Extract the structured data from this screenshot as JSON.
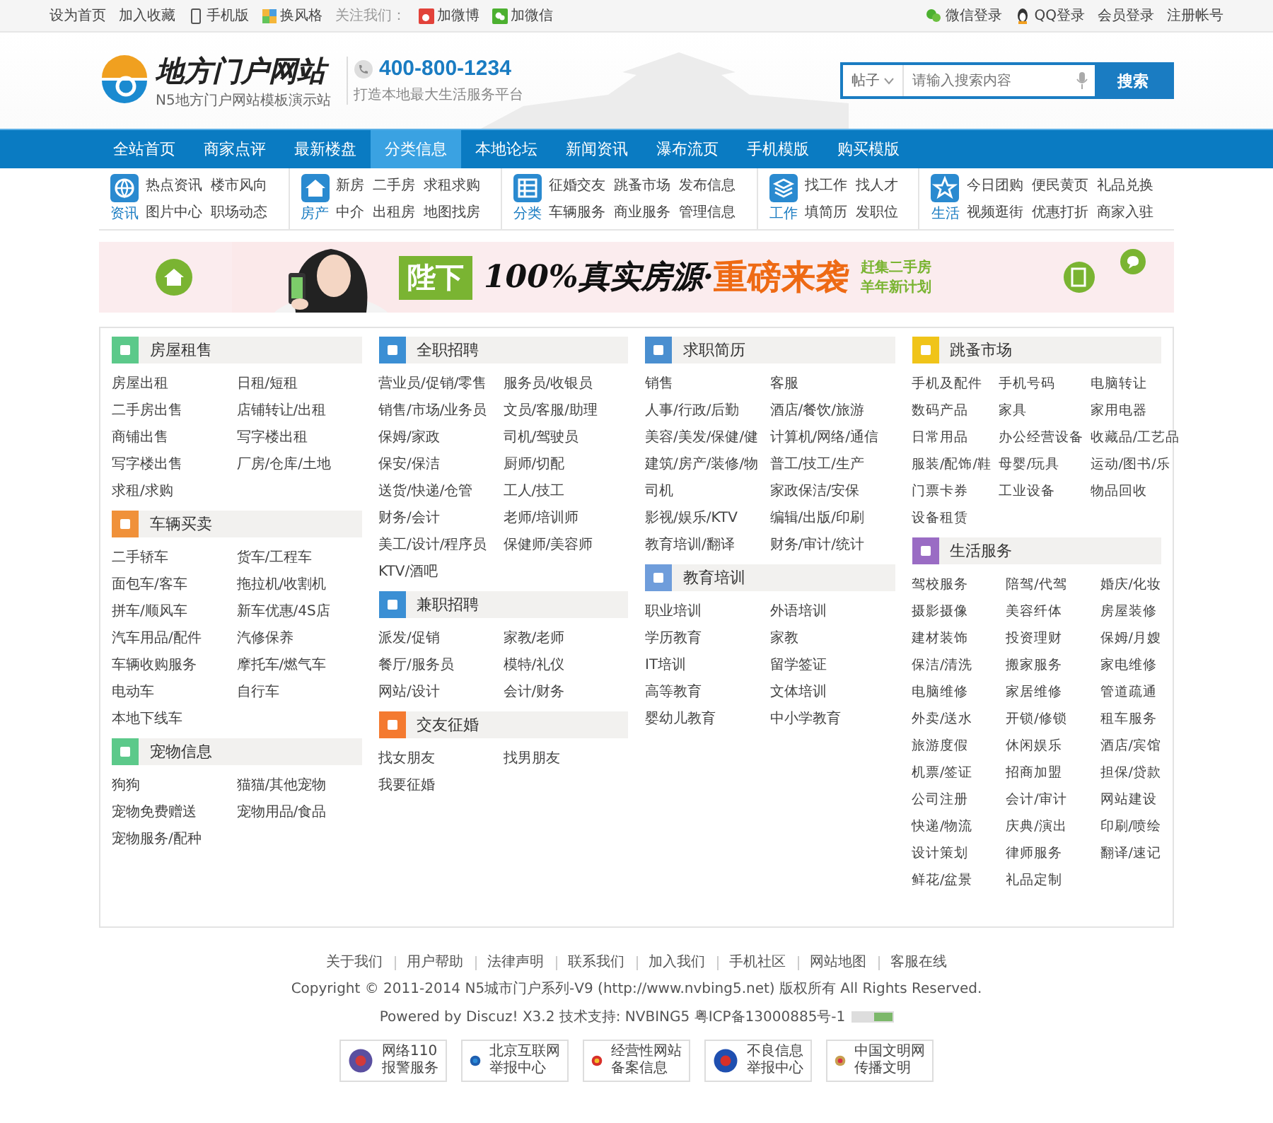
{
  "topbar": {
    "left": [
      {
        "text": "设为首页",
        "kind": "link"
      },
      {
        "text": "加入收藏",
        "kind": "link"
      },
      {
        "text": "手机版",
        "kind": "phone"
      },
      {
        "text": "换风格",
        "kind": "style"
      },
      {
        "text": "关注我们：",
        "kind": "label"
      },
      {
        "text": "加微博",
        "kind": "weibo"
      },
      {
        "text": "加微信",
        "kind": "wechat"
      }
    ],
    "right": [
      {
        "text": "微信登录",
        "kind": "wechat"
      },
      {
        "text": "QQ登录",
        "kind": "qq"
      },
      {
        "text": "会员登录",
        "kind": "link"
      },
      {
        "text": "注册帐号",
        "kind": "link"
      }
    ]
  },
  "header": {
    "logo_title": "地方门户网站",
    "logo_subtitle": "N5地方门户网站模板演示站",
    "phone": "400-800-1234",
    "slogan": "打造本地最大生活服务平台",
    "search": {
      "scope": "帖子",
      "placeholder": "请输入搜索内容",
      "button": "搜索"
    }
  },
  "nav": [
    {
      "label": "全站首页",
      "selected": false
    },
    {
      "label": "商家点评",
      "selected": false
    },
    {
      "label": "最新楼盘",
      "selected": false
    },
    {
      "label": "分类信息",
      "selected": true
    },
    {
      "label": "本地论坛",
      "selected": false
    },
    {
      "label": "新闻资讯",
      "selected": false
    },
    {
      "label": "瀑布流页",
      "selected": false
    },
    {
      "label": "手机模版",
      "selected": false
    },
    {
      "label": "购买模版",
      "selected": false
    }
  ],
  "subnav": [
    {
      "label": "资讯",
      "rows": [
        [
          "热点资讯",
          "楼市风向"
        ],
        [
          "图片中心",
          "职场动态"
        ]
      ]
    },
    {
      "label": "房产",
      "rows": [
        [
          "新房",
          "二手房",
          "求租求购"
        ],
        [
          "中介",
          "出租房",
          "地图找房"
        ]
      ]
    },
    {
      "label": "分类",
      "rows": [
        [
          "征婚交友",
          "跳蚤市场",
          "发布信息"
        ],
        [
          "车辆服务",
          "商业服务",
          "管理信息"
        ]
      ]
    },
    {
      "label": "工作",
      "rows": [
        [
          "找工作",
          "找人才"
        ],
        [
          "填简历",
          "发职位"
        ]
      ]
    },
    {
      "label": "生活",
      "rows": [
        [
          "今日团购",
          "便民黄页",
          "礼品兑换"
        ],
        [
          "视频逛街",
          "优惠打折",
          "商家入驻"
        ]
      ]
    }
  ],
  "banner": {
    "badge": "陛下",
    "headline": "100%真实房源·",
    "highlight": "重磅来袭",
    "side": [
      "赶集二手房",
      "羊年新计划"
    ]
  },
  "categories": [
    [
      {
        "title": "房屋租售",
        "color": "#5cc98a",
        "items": [
          "房屋出租",
          "日租/短租",
          "二手房出售",
          "店铺转让/出租",
          "商铺出售",
          "写字楼出租",
          "写字楼出售",
          "厂房/仓库/土地",
          "求租/求购"
        ]
      },
      {
        "title": "车辆买卖",
        "color": "#f0913a",
        "items": [
          "二手轿车",
          "货车/工程车",
          "面包车/客车",
          "拖拉机/收割机",
          "拼车/顺风车",
          "新车优惠/4S店",
          "汽车用品/配件",
          "汽修保养",
          "车辆收购服务",
          "摩托车/燃气车",
          "电动车",
          "自行车",
          "本地下线车"
        ]
      },
      {
        "title": "宠物信息",
        "color": "#5cc98a",
        "items": [
          "狗狗",
          "猫猫/其他宠物",
          "宠物免费赠送",
          "宠物用品/食品",
          "宠物服务/配种"
        ]
      }
    ],
    [
      {
        "title": "全职招聘",
        "color": "#3b8fd4",
        "items": [
          "营业员/促销/零售",
          "服务员/收银员",
          "销售/市场/业务员",
          "文员/客服/助理",
          "保姆/家政",
          "司机/驾驶员",
          "保安/保洁",
          "厨师/切配",
          "送货/快递/仓管",
          "工人/技工",
          "财务/会计",
          "老师/培训师",
          "美工/设计/程序员",
          "保健师/美容师",
          "KTV/酒吧"
        ]
      },
      {
        "title": "兼职招聘",
        "color": "#3b8fd4",
        "items": [
          "派发/促销",
          "家教/老师",
          "餐厅/服务员",
          "模特/礼仪",
          "网站/设计",
          "会计/财务"
        ]
      },
      {
        "title": "交友征婚",
        "color": "#f47a30",
        "items": [
          "找女朋友",
          "找男朋友",
          "我要征婚"
        ]
      }
    ],
    [
      {
        "title": "求职简历",
        "color": "#4a8fd0",
        "items": [
          "销售",
          "客服",
          "人事/行政/后勤",
          "酒店/餐饮/旅游",
          "美容/美发/保健/健",
          "计算机/网络/通信",
          "建筑/房产/装修/物",
          "普工/技工/生产",
          "司机",
          "家政保洁/安保",
          "影视/娱乐/KTV",
          "编辑/出版/印刷",
          "教育培训/翻译",
          "财务/审计/统计"
        ]
      },
      {
        "title": "教育培训",
        "color": "#6f9ddb",
        "items": [
          "职业培训",
          "外语培训",
          "学历教育",
          "家教",
          "IT培训",
          "留学签证",
          "高等教育",
          "文体培训",
          "婴幼儿教育",
          "中小学教育"
        ]
      }
    ],
    [
      {
        "title": "跳蚤市场",
        "color": "#f0c419",
        "items": [
          "手机及配件",
          "手机号码",
          "电脑转让",
          "数码产品",
          "家具",
          "家用电器",
          "日常用品",
          "办公经营设备",
          "收藏品/工艺品",
          "服装/配饰/鞋",
          "母婴/玩具",
          "运动/图书/乐",
          "门票卡券",
          "工业设备",
          "物品回收",
          "设备租赁"
        ]
      },
      {
        "title": "生活服务",
        "color": "#9a6cc4",
        "items": [
          "驾校服务",
          "陪驾/代驾",
          "婚庆/化妆",
          "摄影摄像",
          "美容纤体",
          "房屋装修",
          "建材装饰",
          "投资理财",
          "保姆/月嫂",
          "保洁/清洗",
          "搬家服务",
          "家电维修",
          "电脑维修",
          "家居维修",
          "管道疏通",
          "外卖/送水",
          "开锁/修锁",
          "租车服务",
          "旅游度假",
          "休闲娱乐",
          "酒店/宾馆",
          "机票/签证",
          "招商加盟",
          "担保/贷款",
          "公司注册",
          "会计/审计",
          "网站建设",
          "快递/物流",
          "庆典/演出",
          "印刷/喷绘",
          "设计策划",
          "律师服务",
          "翻译/速记",
          "鲜花/盆景",
          "礼品定制"
        ]
      }
    ]
  ],
  "footer": {
    "links": [
      "关于我们",
      "用户帮助",
      "法律声明",
      "联系我们",
      "加入我们",
      "手机社区",
      "网站地图",
      "客服在线"
    ],
    "copyright": "Copyright © 2011-2014 N5城市门户系列-V9 (http://www.nvbing5.net) 版权所有 All Rights Reserved.",
    "powered": "Powered by Discuz! X3.2 技术支持: NVBING5 粤ICP备13000885号-1",
    "badges": [
      {
        "lines": [
          "网络110",
          "报警服务"
        ]
      },
      {
        "lines": [
          "北京互联网",
          "举报中心"
        ]
      },
      {
        "lines": [
          "经营性网站",
          "备案信息"
        ]
      },
      {
        "lines": [
          "不良信息",
          "举报中心"
        ]
      },
      {
        "lines": [
          "中国文明网",
          "传播文明"
        ]
      }
    ]
  }
}
